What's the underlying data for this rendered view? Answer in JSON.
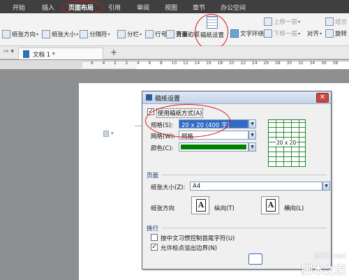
{
  "menu": {
    "items": [
      "开始",
      "插入",
      "页面布局",
      "引用",
      "审阅",
      "视图",
      "章节",
      "办公空间"
    ],
    "selected": "页面布局"
  },
  "ribbon": {
    "paper_direction": "纸张方向",
    "paper_size": "纸张大小",
    "separator": "分隔符",
    "columns": "分栏",
    "line_number": "行号",
    "background": "背景",
    "page_border": "页面边框",
    "manuscript_settings": "稿纸设置",
    "text_wrap": "文字环绕",
    "bring_forward": "上移一层",
    "send_backward": "下移一层",
    "align": "对齐",
    "group": "组合",
    "rotate": "旋转"
  },
  "tabbar": {
    "doc_tab": "文档 1 *",
    "new_tab": "+"
  },
  "ruler": {
    "ticks": [
      "6",
      "4",
      "2",
      "2",
      "4",
      "6",
      "8",
      "10",
      "12",
      "14",
      "16",
      "18",
      "20",
      "22",
      "24",
      "26",
      "28",
      "30",
      "32",
      "34",
      "36",
      "38"
    ]
  },
  "dialog": {
    "title": "稿纸设置",
    "use_manuscript": "使用稿纸方式(A)",
    "use_manuscript_checked": true,
    "spec_label": "规格(S):",
    "spec_value": "20 x 20 (400 字)",
    "grid_label": "网格(W):",
    "grid_value": "网格",
    "color_label": "颜色(C):",
    "color_value": "#008000",
    "preview_label": "20 x 20",
    "page_section": "页面",
    "paper_size_label": "纸张大小(Z):",
    "paper_size_value": "A4",
    "orientation_label": "纸张方向",
    "portrait_label": "纵向(T)",
    "landscape_label": "横向(L)",
    "wrap_section": "换行",
    "opt1": "按中文习惯控制首尾字符(U)",
    "opt1_checked": false,
    "opt2": "允许标点溢出边界(N)",
    "opt2_checked": true
  },
  "watermark": {
    "line1": "jb51.net",
    "line2": "脚本之家"
  }
}
